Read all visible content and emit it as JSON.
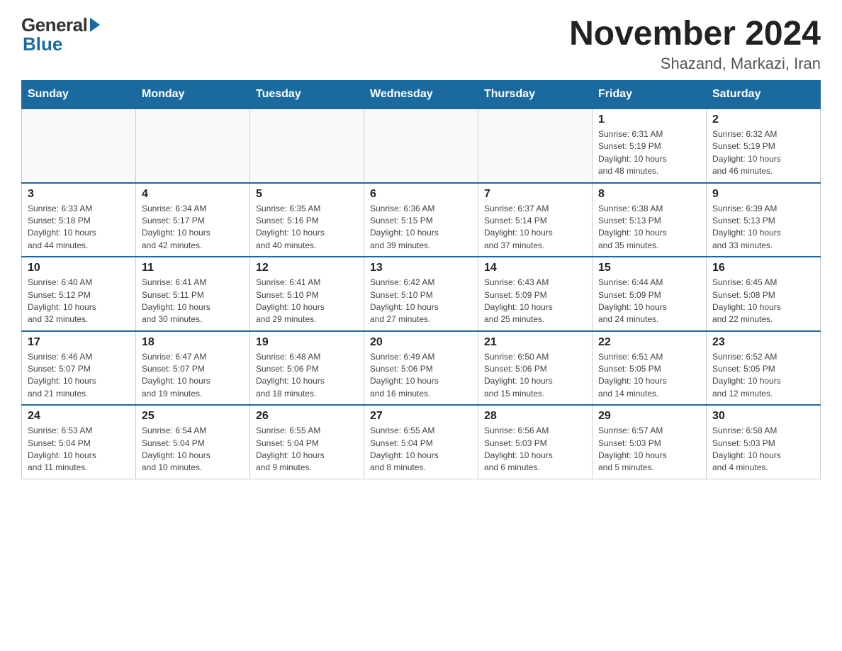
{
  "logo": {
    "general": "General",
    "blue": "Blue"
  },
  "title": "November 2024",
  "subtitle": "Shazand, Markazi, Iran",
  "weekdays": [
    "Sunday",
    "Monday",
    "Tuesday",
    "Wednesday",
    "Thursday",
    "Friday",
    "Saturday"
  ],
  "weeks": [
    [
      {
        "day": "",
        "info": ""
      },
      {
        "day": "",
        "info": ""
      },
      {
        "day": "",
        "info": ""
      },
      {
        "day": "",
        "info": ""
      },
      {
        "day": "",
        "info": ""
      },
      {
        "day": "1",
        "info": "Sunrise: 6:31 AM\nSunset: 5:19 PM\nDaylight: 10 hours\nand 48 minutes."
      },
      {
        "day": "2",
        "info": "Sunrise: 6:32 AM\nSunset: 5:19 PM\nDaylight: 10 hours\nand 46 minutes."
      }
    ],
    [
      {
        "day": "3",
        "info": "Sunrise: 6:33 AM\nSunset: 5:18 PM\nDaylight: 10 hours\nand 44 minutes."
      },
      {
        "day": "4",
        "info": "Sunrise: 6:34 AM\nSunset: 5:17 PM\nDaylight: 10 hours\nand 42 minutes."
      },
      {
        "day": "5",
        "info": "Sunrise: 6:35 AM\nSunset: 5:16 PM\nDaylight: 10 hours\nand 40 minutes."
      },
      {
        "day": "6",
        "info": "Sunrise: 6:36 AM\nSunset: 5:15 PM\nDaylight: 10 hours\nand 39 minutes."
      },
      {
        "day": "7",
        "info": "Sunrise: 6:37 AM\nSunset: 5:14 PM\nDaylight: 10 hours\nand 37 minutes."
      },
      {
        "day": "8",
        "info": "Sunrise: 6:38 AM\nSunset: 5:13 PM\nDaylight: 10 hours\nand 35 minutes."
      },
      {
        "day": "9",
        "info": "Sunrise: 6:39 AM\nSunset: 5:13 PM\nDaylight: 10 hours\nand 33 minutes."
      }
    ],
    [
      {
        "day": "10",
        "info": "Sunrise: 6:40 AM\nSunset: 5:12 PM\nDaylight: 10 hours\nand 32 minutes."
      },
      {
        "day": "11",
        "info": "Sunrise: 6:41 AM\nSunset: 5:11 PM\nDaylight: 10 hours\nand 30 minutes."
      },
      {
        "day": "12",
        "info": "Sunrise: 6:41 AM\nSunset: 5:10 PM\nDaylight: 10 hours\nand 29 minutes."
      },
      {
        "day": "13",
        "info": "Sunrise: 6:42 AM\nSunset: 5:10 PM\nDaylight: 10 hours\nand 27 minutes."
      },
      {
        "day": "14",
        "info": "Sunrise: 6:43 AM\nSunset: 5:09 PM\nDaylight: 10 hours\nand 25 minutes."
      },
      {
        "day": "15",
        "info": "Sunrise: 6:44 AM\nSunset: 5:09 PM\nDaylight: 10 hours\nand 24 minutes."
      },
      {
        "day": "16",
        "info": "Sunrise: 6:45 AM\nSunset: 5:08 PM\nDaylight: 10 hours\nand 22 minutes."
      }
    ],
    [
      {
        "day": "17",
        "info": "Sunrise: 6:46 AM\nSunset: 5:07 PM\nDaylight: 10 hours\nand 21 minutes."
      },
      {
        "day": "18",
        "info": "Sunrise: 6:47 AM\nSunset: 5:07 PM\nDaylight: 10 hours\nand 19 minutes."
      },
      {
        "day": "19",
        "info": "Sunrise: 6:48 AM\nSunset: 5:06 PM\nDaylight: 10 hours\nand 18 minutes."
      },
      {
        "day": "20",
        "info": "Sunrise: 6:49 AM\nSunset: 5:06 PM\nDaylight: 10 hours\nand 16 minutes."
      },
      {
        "day": "21",
        "info": "Sunrise: 6:50 AM\nSunset: 5:06 PM\nDaylight: 10 hours\nand 15 minutes."
      },
      {
        "day": "22",
        "info": "Sunrise: 6:51 AM\nSunset: 5:05 PM\nDaylight: 10 hours\nand 14 minutes."
      },
      {
        "day": "23",
        "info": "Sunrise: 6:52 AM\nSunset: 5:05 PM\nDaylight: 10 hours\nand 12 minutes."
      }
    ],
    [
      {
        "day": "24",
        "info": "Sunrise: 6:53 AM\nSunset: 5:04 PM\nDaylight: 10 hours\nand 11 minutes."
      },
      {
        "day": "25",
        "info": "Sunrise: 6:54 AM\nSunset: 5:04 PM\nDaylight: 10 hours\nand 10 minutes."
      },
      {
        "day": "26",
        "info": "Sunrise: 6:55 AM\nSunset: 5:04 PM\nDaylight: 10 hours\nand 9 minutes."
      },
      {
        "day": "27",
        "info": "Sunrise: 6:55 AM\nSunset: 5:04 PM\nDaylight: 10 hours\nand 8 minutes."
      },
      {
        "day": "28",
        "info": "Sunrise: 6:56 AM\nSunset: 5:03 PM\nDaylight: 10 hours\nand 6 minutes."
      },
      {
        "day": "29",
        "info": "Sunrise: 6:57 AM\nSunset: 5:03 PM\nDaylight: 10 hours\nand 5 minutes."
      },
      {
        "day": "30",
        "info": "Sunrise: 6:58 AM\nSunset: 5:03 PM\nDaylight: 10 hours\nand 4 minutes."
      }
    ]
  ]
}
